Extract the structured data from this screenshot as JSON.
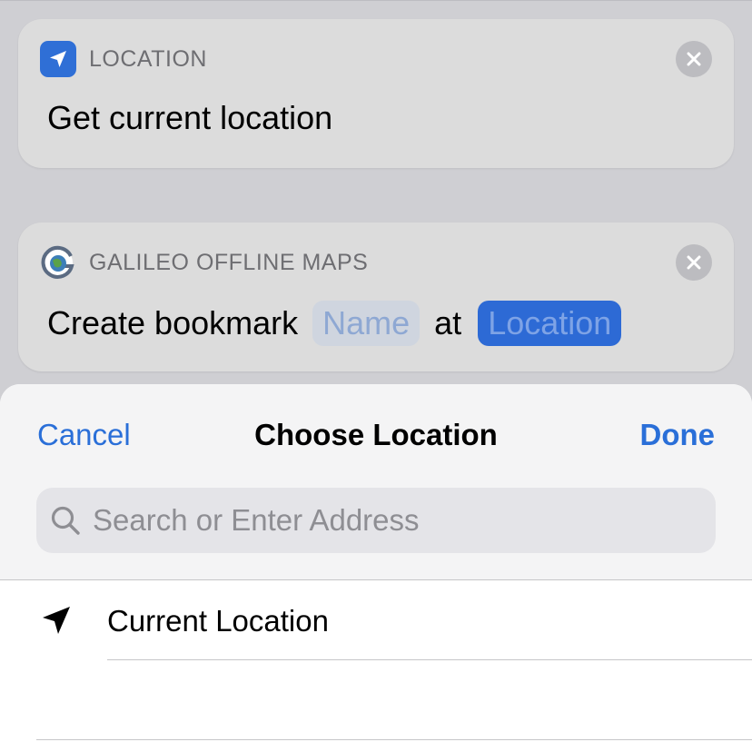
{
  "actions": [
    {
      "category": "LOCATION",
      "icon": "location-arrow-icon",
      "text": "Get current location"
    },
    {
      "category": "GALILEO OFFLINE MAPS",
      "icon": "galileo-globe-icon",
      "text_before": "Create bookmark",
      "name_token": "Name",
      "text_between": "at",
      "location_token": "Location"
    }
  ],
  "sheet": {
    "cancel_label": "Cancel",
    "title": "Choose Location",
    "done_label": "Done",
    "search_placeholder": "Search or Enter Address",
    "items": [
      {
        "label": "Current Location",
        "icon": "location-arrow-icon"
      }
    ]
  },
  "colors": {
    "accent": "#2a6fd8",
    "location_token": "#2d6ad5",
    "location_app_icon": "#2f6fd6"
  }
}
